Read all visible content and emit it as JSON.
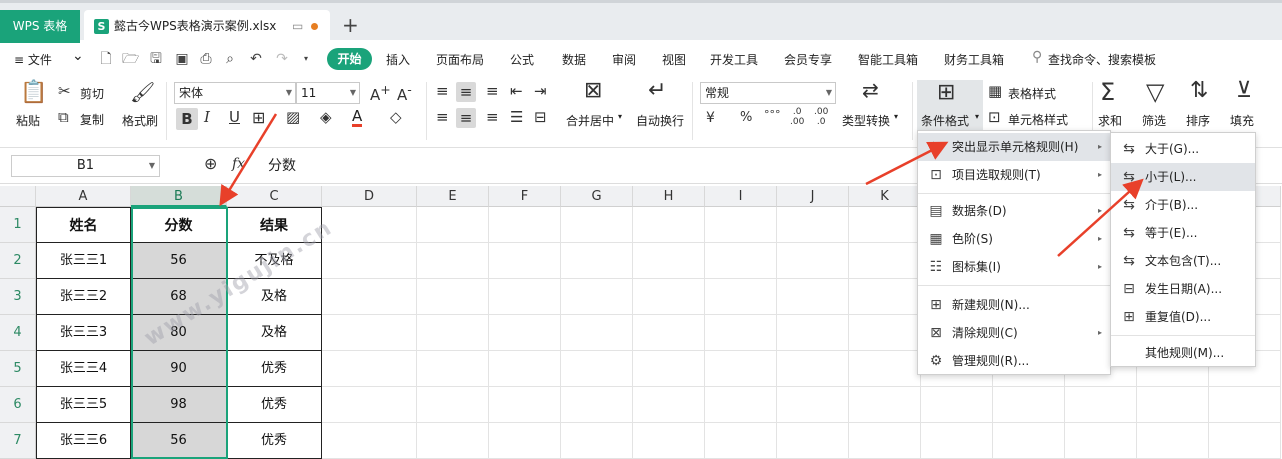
{
  "titlebar": {
    "app_tab": "WPS 表格",
    "file_tab": "懿古今WPS表格演示案例.xlsx",
    "file_icon_letter": "S",
    "new_tab": "+"
  },
  "menubar": {
    "file_menu": "≡ 文件",
    "file_chevron": "⌄",
    "tabs": [
      "开始",
      "插入",
      "页面布局",
      "公式",
      "数据",
      "审阅",
      "视图",
      "开发工具",
      "会员专享",
      "智能工具箱",
      "财务工具箱"
    ],
    "search": "查找命令、搜索模板"
  },
  "ribbon": {
    "paste": "粘贴",
    "cut": "剪切",
    "copy": "复制",
    "format_painter": "格式刷",
    "font_name": "宋体",
    "font_size": "11",
    "merge_center": "合并居中",
    "wrap_text": "自动换行",
    "number_format": "常规",
    "type_convert": "类型转换",
    "cond_format": "条件格式",
    "table_style": "表格样式",
    "cell_style": "单元格样式",
    "sum": "求和",
    "filter": "筛选",
    "sort": "排序",
    "fill": "填充",
    "currency_symbol": "¥",
    "percent_symbol": "%"
  },
  "formulabar": {
    "name_box": "B1",
    "fx": "fx",
    "formula": "分数"
  },
  "sheet": {
    "columns": [
      "A",
      "B",
      "C",
      "D",
      "E",
      "F",
      "G",
      "H",
      "I",
      "J",
      "K"
    ],
    "selected_column": "B",
    "rows": [
      "1",
      "2",
      "3",
      "4",
      "5",
      "6",
      "7"
    ],
    "header": [
      "姓名",
      "分数",
      "结果"
    ],
    "data": [
      [
        "张三三1",
        "56",
        "不及格"
      ],
      [
        "张三三2",
        "68",
        "及格"
      ],
      [
        "张三三3",
        "80",
        "及格"
      ],
      [
        "张三三4",
        "90",
        "优秀"
      ],
      [
        "张三三5",
        "98",
        "优秀"
      ],
      [
        "张三三6",
        "56",
        "优秀"
      ]
    ]
  },
  "cond_menu": {
    "items": [
      {
        "label": "突出显示单元格规则(H)",
        "icon": "highlight-rules-icon",
        "has_sub": true
      },
      {
        "label": "项目选取规则(T)",
        "icon": "top-bottom-rules-icon",
        "has_sub": true
      },
      {
        "label": "数据条(D)",
        "icon": "data-bars-icon",
        "has_sub": true
      },
      {
        "label": "色阶(S)",
        "icon": "color-scales-icon",
        "has_sub": true
      },
      {
        "label": "图标集(I)",
        "icon": "icon-sets-icon",
        "has_sub": true
      },
      {
        "label": "新建规则(N)...",
        "icon": "new-rule-icon",
        "has_sub": false
      },
      {
        "label": "清除规则(C)",
        "icon": "clear-rules-icon",
        "has_sub": true
      },
      {
        "label": "管理规则(R)...",
        "icon": "manage-rules-icon",
        "has_sub": false
      }
    ]
  },
  "highlight_submenu": {
    "items": [
      "大于(G)...",
      "小于(L)...",
      "介于(B)...",
      "等于(E)...",
      "文本包含(T)...",
      "发生日期(A)...",
      "重复值(D)..."
    ],
    "other": "其他规则(M)..."
  },
  "watermark": "www.yigujin.cn",
  "colors": {
    "accent": "#1aa37a",
    "arrow": "#e8402a",
    "selection_fill": "#d7d7d7"
  }
}
